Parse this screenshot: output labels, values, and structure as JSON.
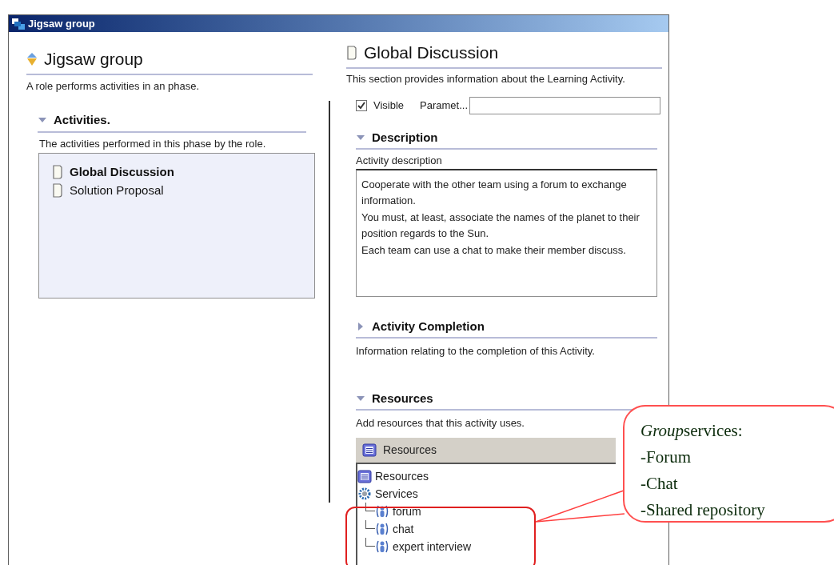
{
  "window": {
    "title": "Jigsaw group"
  },
  "role": {
    "title": "Jigsaw group",
    "description": "A role performs activities in an phase."
  },
  "activities": {
    "title": "Activities.",
    "expanded": true,
    "description": "The activities performed in this phase by the role.",
    "items": [
      {
        "label": "Global Discussion",
        "selected": true
      },
      {
        "label": "Solution Proposal",
        "selected": false
      }
    ]
  },
  "activity": {
    "title": "Global Discussion",
    "description": "This section provides information about the Learning Activity.",
    "visible": {
      "label": "Visible",
      "checked": true
    },
    "parameter": {
      "label": "Paramet..."
    }
  },
  "description_section": {
    "title": "Description",
    "expanded": true,
    "label": "Activity description",
    "paragraphs": [
      "Cooperate with the other team using a forum to exchange information.",
      "You must, at least, associate the names of the planet to their position regards to the Sun.",
      "Each team can use a chat to make their member discuss."
    ]
  },
  "completion_section": {
    "title": "Activity Completion",
    "expanded": false,
    "description": "Information relating to the completion of this Activity."
  },
  "resources_section": {
    "title": "Resources",
    "expanded": true,
    "description": "Add resources that this activity uses.",
    "header": "Resources",
    "tree": [
      {
        "label": "Resources",
        "kind": "folder"
      },
      {
        "label": "Services",
        "kind": "gear",
        "children": [
          {
            "label": "forum",
            "kind": "service"
          },
          {
            "label": "chat",
            "kind": "service"
          },
          {
            "label": "expert  interview",
            "kind": "service"
          }
        ]
      }
    ]
  },
  "callout": {
    "title": [
      {
        "text": "Group",
        "italic": true
      },
      {
        "text": "services:",
        "italic": false
      }
    ],
    "lines": [
      "-Forum",
      "-Chat",
      "-Shared repository"
    ]
  }
}
